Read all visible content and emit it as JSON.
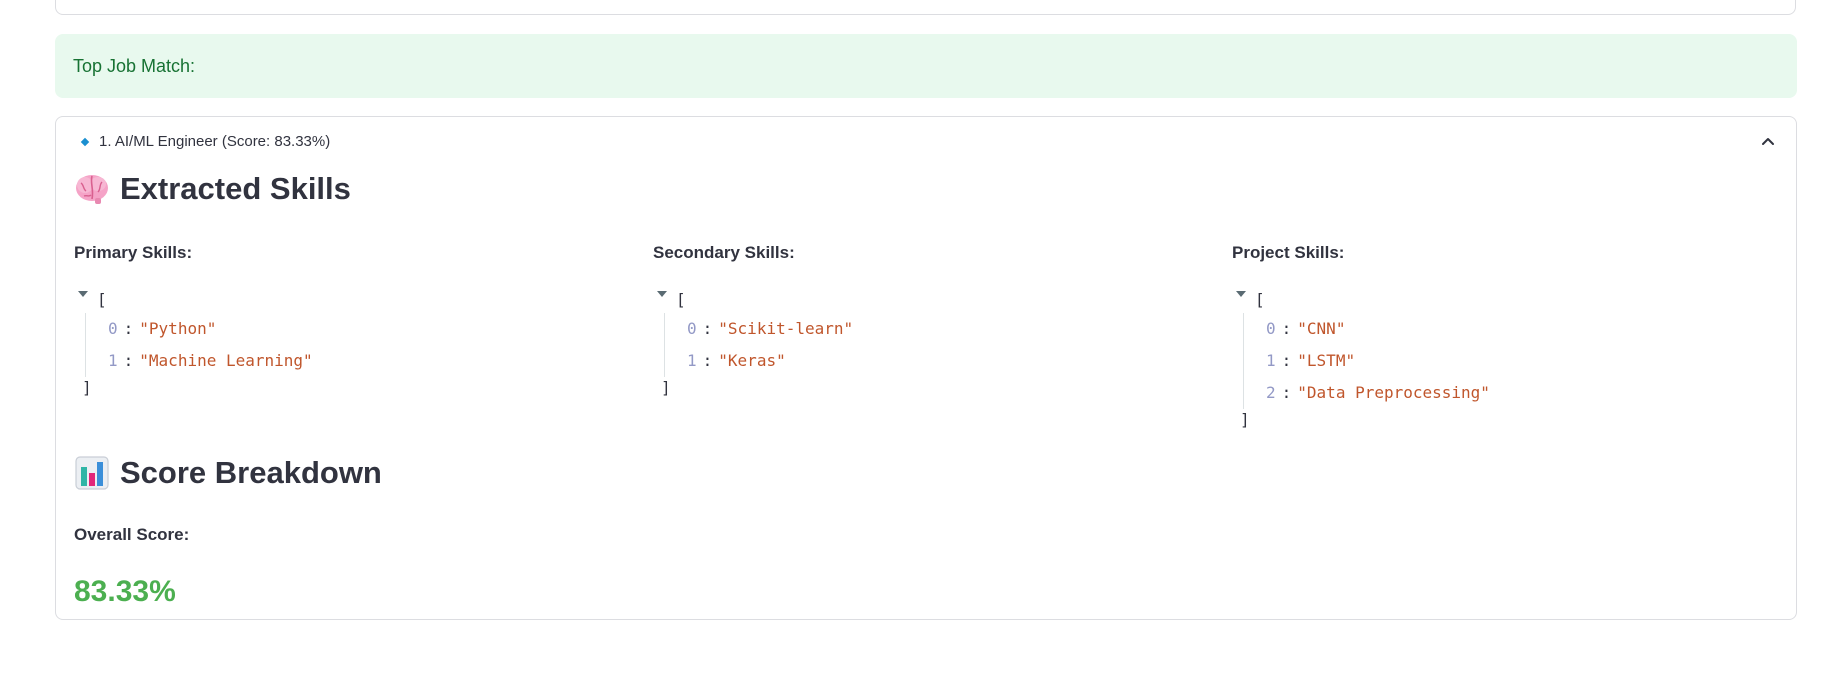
{
  "success_banner": {
    "text": "Top Job Match:"
  },
  "expander": {
    "title": "1. AI/ML Engineer (Score: 83.33%)",
    "expanded": true,
    "extracted_skills": {
      "heading": "Extracted Skills",
      "icon": "brain-icon",
      "primary": {
        "label": "Primary Skills:",
        "open_bracket": "[",
        "close_bracket": "]",
        "items": [
          {
            "index": "0",
            "value": "\"Python\""
          },
          {
            "index": "1",
            "value": "\"Machine Learning\""
          }
        ]
      },
      "secondary": {
        "label": "Secondary Skills:",
        "open_bracket": "[",
        "close_bracket": "]",
        "items": [
          {
            "index": "0",
            "value": "\"Scikit-learn\""
          },
          {
            "index": "1",
            "value": "\"Keras\""
          }
        ]
      },
      "project": {
        "label": "Project Skills:",
        "open_bracket": "[",
        "close_bracket": "]",
        "items": [
          {
            "index": "0",
            "value": "\"CNN\""
          },
          {
            "index": "1",
            "value": "\"LSTM\""
          },
          {
            "index": "2",
            "value": "\"Data Preprocessing\""
          }
        ]
      }
    },
    "score_breakdown": {
      "heading": "Score Breakdown",
      "icon": "bar-chart-icon",
      "overall_label": "Overall Score:",
      "overall_value": "83.33%"
    }
  },
  "colors": {
    "success_bg": "#e8f9ee",
    "success_text": "#177233",
    "json_index": "#9399c6",
    "json_string": "#c0562c",
    "score_green": "#4caf50",
    "diamond": "#1a8fd0"
  }
}
